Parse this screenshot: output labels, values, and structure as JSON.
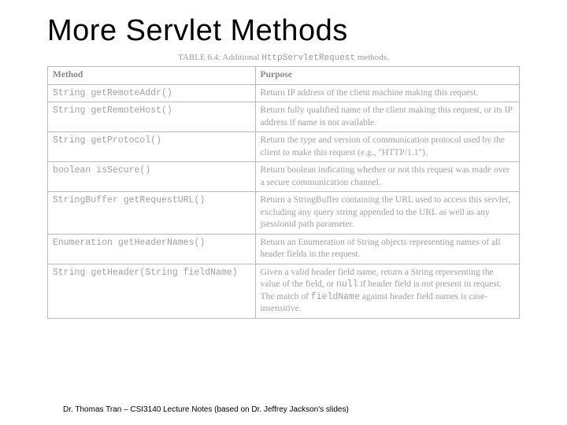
{
  "title": "More Servlet Methods",
  "caption_label": "TABLE 6.4:",
  "caption_text": "Additional ",
  "caption_mono": "HttpServletRequest",
  "caption_suffix": " methods.",
  "headers": {
    "method": "Method",
    "purpose": "Purpose"
  },
  "rows": [
    {
      "ret": "String ",
      "sig": "getRemoteAddr()",
      "purpose": "Return IP address of the client machine making this request."
    },
    {
      "ret": "String ",
      "sig": "getRemoteHost()",
      "purpose": "Return fully qualified name of the client making this request, or its IP address if name is not available."
    },
    {
      "ret": "String ",
      "sig": "getProtocol()",
      "purpose": "Return the type and version of communication protocol used by the client to make this request (e.g., \"HTTP/1.1\")."
    },
    {
      "ret": "boolean ",
      "sig": "isSecure()",
      "purpose": "Return boolean indicating whether or not this request was made over a secure communication channel."
    },
    {
      "ret": "StringBuffer ",
      "sig": "getRequestURL()",
      "purpose": "Return a StringBuffer containing the URL used to access this servlet, excluding any query string appended to the URL as well as any jsessionid path parameter."
    },
    {
      "ret": "Enumeration ",
      "sig": "getHeaderNames()",
      "purpose": "Return an Enumeration of String objects representing names of all header fields in the request."
    },
    {
      "ret": "String ",
      "sig": "getHeader(String fieldName)",
      "purpose_parts": [
        {
          "t": "Given a valid header field name, return a String representing the value of the field, or "
        },
        {
          "m": "null"
        },
        {
          "t": " if header field is not present in request. The match of "
        },
        {
          "m": "fieldName"
        },
        {
          "t": " against header field names is case-insensitive."
        }
      ]
    }
  ],
  "footer": "Dr. Thomas Tran – CSI3140 Lecture Notes (based on Dr. Jeffrey Jackson's slides)"
}
